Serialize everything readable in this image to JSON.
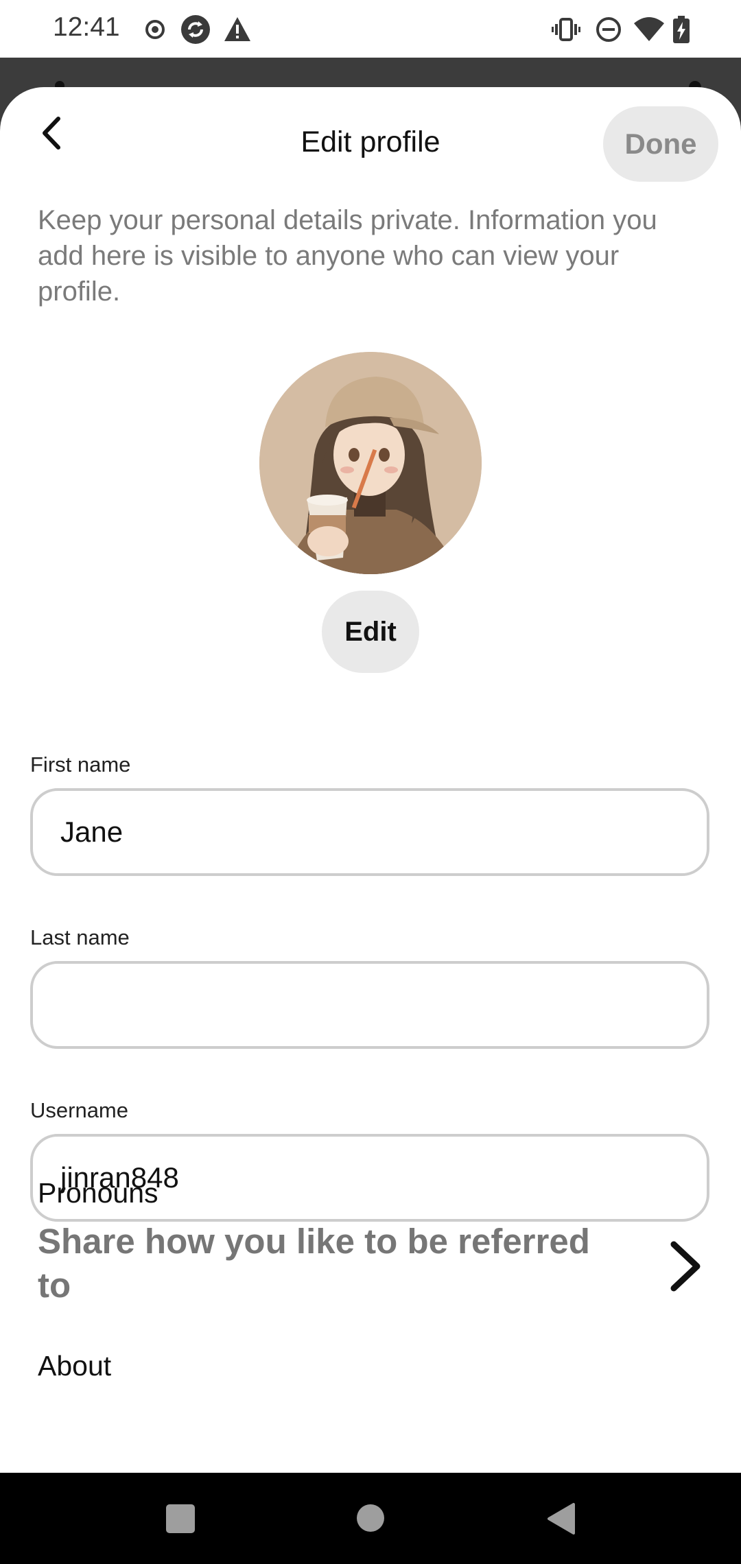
{
  "status_bar": {
    "time": "12:41"
  },
  "header": {
    "title": "Edit profile",
    "done_label": "Done"
  },
  "privacy_note": "Keep your personal details private. Information you add here is visible to anyone who can view your profile.",
  "avatar": {
    "edit_label": "Edit"
  },
  "fields": {
    "first_name": {
      "label": "First name",
      "value": "Jane"
    },
    "last_name": {
      "label": "Last name",
      "value": ""
    },
    "username": {
      "label": "Username",
      "value": "jinran848"
    }
  },
  "pronouns": {
    "label": "Pronouns",
    "value": "Share how you like to be referred to"
  },
  "about": {
    "label": "About"
  },
  "colors": {
    "done_button_bg": "#e9e9e9",
    "done_text": "#8a8a8a",
    "field_border": "#cdcdcd",
    "secondary_text": "#767676",
    "backdrop": "#3c3c3c"
  },
  "icons": {
    "status": [
      "record-icon",
      "sync-icon",
      "warning-icon",
      "vibrate-icon",
      "do-not-disturb-icon",
      "wifi-icon",
      "battery-charging-icon"
    ],
    "back": "chevron-left-icon",
    "pronouns_arrow": "chevron-right-icon",
    "nav": [
      "recents-square-icon",
      "home-circle-icon",
      "back-triangle-icon"
    ]
  }
}
